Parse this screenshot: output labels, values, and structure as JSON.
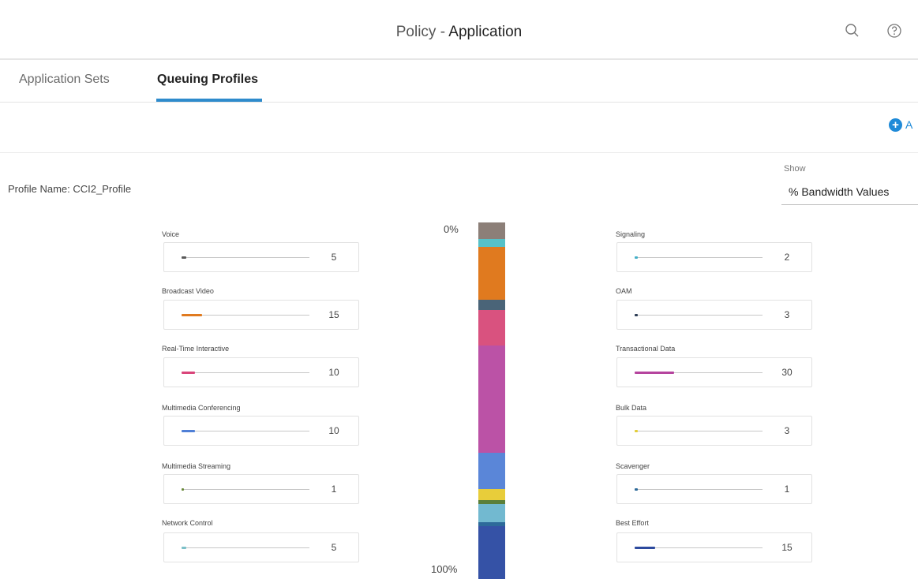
{
  "header": {
    "title_prefix": "Policy",
    "title_sep": " - ",
    "title_main": "Application",
    "icons": [
      "search-icon",
      "help-icon"
    ]
  },
  "tabs": [
    {
      "label": "Application Sets",
      "active": false
    },
    {
      "label": "Queuing Profiles",
      "active": true
    }
  ],
  "toolbar": {
    "add_label": "A",
    "add_icon": "plus-circle-icon",
    "accent": "#1f8ad8"
  },
  "profile": {
    "name_text": "Profile Name: CCI2_Profile",
    "show_label": "Show",
    "show_value": "% Bandwidth Values"
  },
  "column_labels": {
    "top": "0%",
    "bottom": "100%"
  },
  "traffic_classes": {
    "left": [
      {
        "label": "Voice",
        "value": "5",
        "color": "#5a5a5a"
      },
      {
        "label": "Broadcast Video",
        "value": "15",
        "color": "#e07a1f"
      },
      {
        "label": "Real-Time Interactive",
        "value": "10",
        "color": "#d9457a"
      },
      {
        "label": "Multimedia Conferencing",
        "value": "10",
        "color": "#4f7fd6"
      },
      {
        "label": "Multimedia Streaming",
        "value": "1",
        "color": "#6a8a3a"
      },
      {
        "label": "Network Control",
        "value": "5",
        "color": "#7cc0c8"
      }
    ],
    "right": [
      {
        "label": "Signaling",
        "value": "2",
        "color": "#45b0c8"
      },
      {
        "label": "OAM",
        "value": "3",
        "color": "#2d3d55"
      },
      {
        "label": "Transactional Data",
        "value": "30",
        "color": "#b5449e"
      },
      {
        "label": "Bulk Data",
        "value": "3",
        "color": "#e2cd3a"
      },
      {
        "label": "Scavenger",
        "value": "1",
        "color": "#2d6a9a"
      },
      {
        "label": "Best Effort",
        "value": "15",
        "color": "#2d4a9e"
      }
    ]
  },
  "bandwidth_stack": [
    {
      "name": "Voice",
      "percent": 5,
      "color": "#8c7f78"
    },
    {
      "name": "Signaling",
      "percent": 2,
      "color": "#56c1c8"
    },
    {
      "name": "Broadcast Video",
      "percent": 15,
      "color": "#e07a1f"
    },
    {
      "name": "OAM",
      "percent": 3,
      "color": "#4a6478"
    },
    {
      "name": "Real-Time Interactive",
      "percent": 10,
      "color": "#d9527f"
    },
    {
      "name": "Transactional Data",
      "percent": 30,
      "color": "#bb52a6"
    },
    {
      "name": "Multimedia Conferencing",
      "percent": 10,
      "color": "#5a86d8"
    },
    {
      "name": "Bulk Data",
      "percent": 3,
      "color": "#e8cd3a"
    },
    {
      "name": "Multimedia Streaming",
      "percent": 1,
      "color": "#5b7f3a"
    },
    {
      "name": "Network Control",
      "percent": 5,
      "color": "#72b9d0"
    },
    {
      "name": "Scavenger",
      "percent": 1,
      "color": "#2d6a9a"
    },
    {
      "name": "Best Effort",
      "percent": 15,
      "color": "#3552a6"
    }
  ]
}
